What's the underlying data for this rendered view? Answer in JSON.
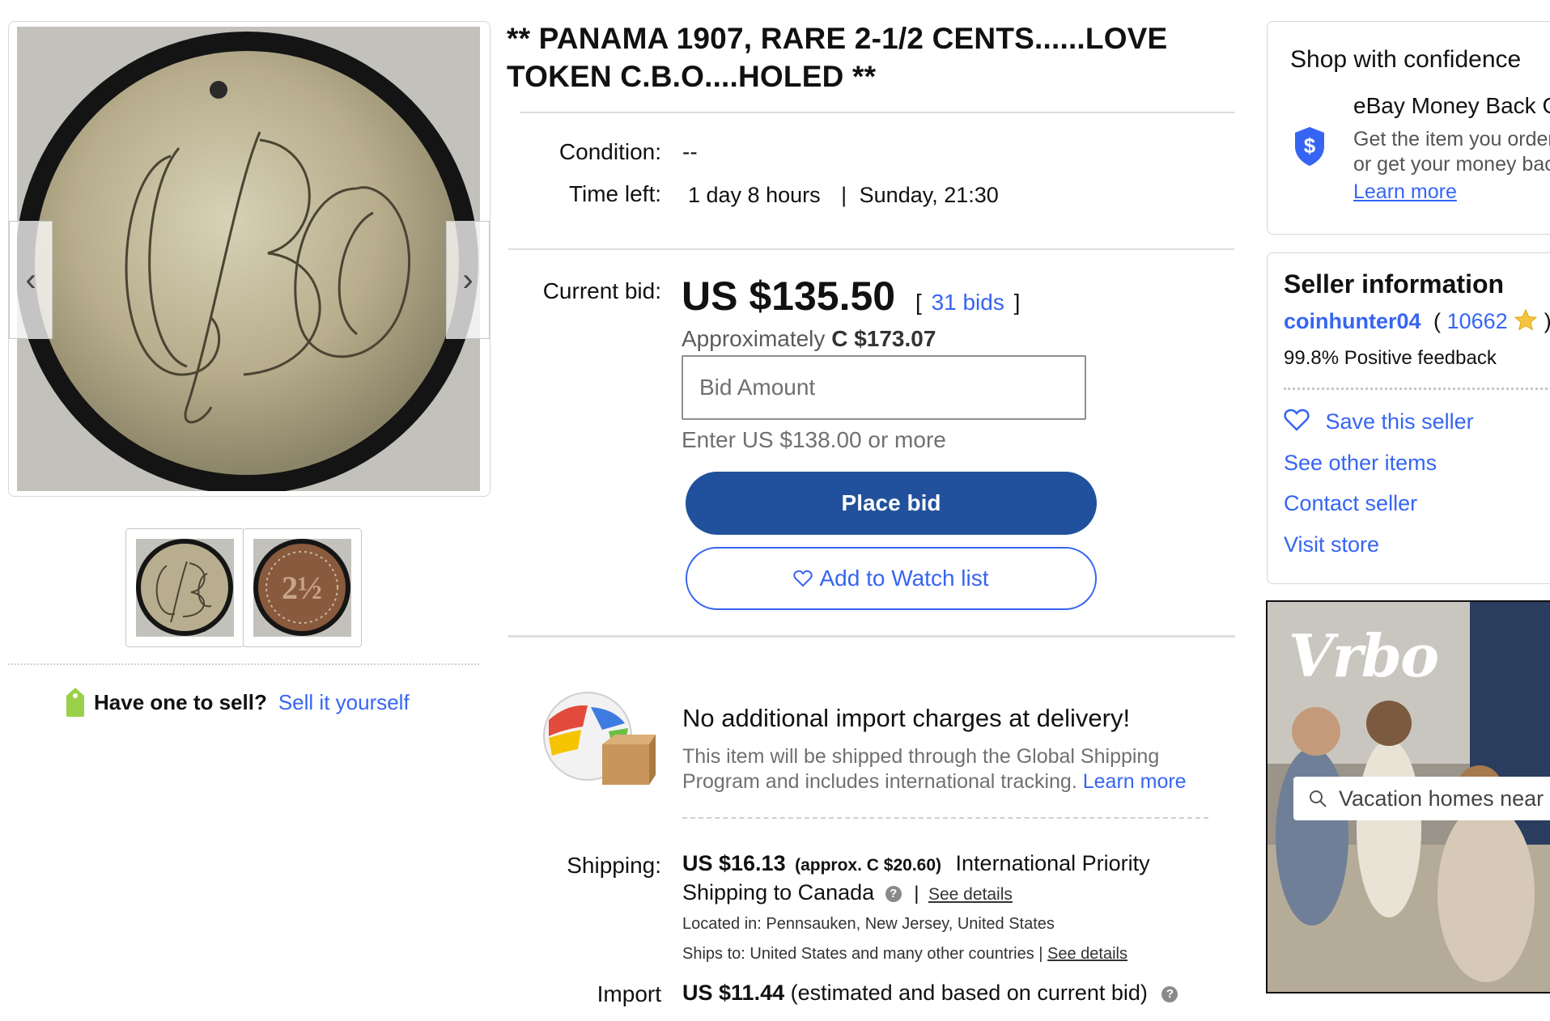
{
  "title": "** PANAMA 1907, RARE 2-1/2 CENTS......LOVE TOKEN C.B.O....HOLED **",
  "gallery": {
    "prev_label": "‹",
    "next_label": "›",
    "thumb_count": 2
  },
  "sell": {
    "question": "Have one to sell?",
    "link": "Sell it yourself"
  },
  "details": {
    "condition_label": "Condition:",
    "condition_value": "--",
    "time_left_label": "Time left:",
    "time_left_value": "1 day 8 hours",
    "separator": "|",
    "end_time": "Sunday, 21:30"
  },
  "bid": {
    "label": "Current bid:",
    "price": "US $135.50",
    "bids_open": "[",
    "bids_count": "31 bids",
    "bids_close": "]",
    "approx_prefix": "Approximately",
    "approx_value": "C $173.07",
    "input_placeholder": "Bid Amount",
    "min_bid_text": "Enter US $138.00 or more",
    "place_bid_label": "Place bid",
    "watch_label": "Add to Watch list"
  },
  "shipping_info": {
    "import_heading": "No additional import charges at delivery!",
    "import_desc": "This item will be shipped through the Global Shipping Program and includes international tracking.",
    "import_learn_more": "Learn more",
    "shipping_label": "Shipping:",
    "shipping_price": "US $16.13",
    "shipping_approx": "(approx. C $20.60)",
    "shipping_method_1": "International Priority",
    "shipping_method_2": "Shipping to Canada",
    "help_glyph": "?",
    "pipe": "|",
    "see_details": "See details",
    "located_in": "Located in:  Pennsauken, New Jersey, United States",
    "ships_to": "Ships to:  United States and many other countries |",
    "import_label": "Import",
    "import_price": "US $11.44",
    "import_note": "(estimated and based on current bid)"
  },
  "confidence": {
    "title": "Shop with confidence",
    "mbg_title": "eBay Money Back Guarantee",
    "mbg_desc": "Get the item you ordered or get your money back.",
    "learn_more": "Learn more"
  },
  "seller": {
    "title": "Seller information",
    "name": "coinhunter04",
    "score_open": "(",
    "score": "10662",
    "score_close": ")",
    "feedback": "99.8% Positive feedback",
    "save": "Save this seller",
    "other_items": "See other items",
    "contact": "Contact seller",
    "store": "Visit store"
  },
  "ad": {
    "brand": "Vrbo",
    "search_placeholder": "Vacation homes near me"
  },
  "colors": {
    "link_blue": "#3665f3",
    "bid_button": "#21519c",
    "text": "#191919"
  }
}
